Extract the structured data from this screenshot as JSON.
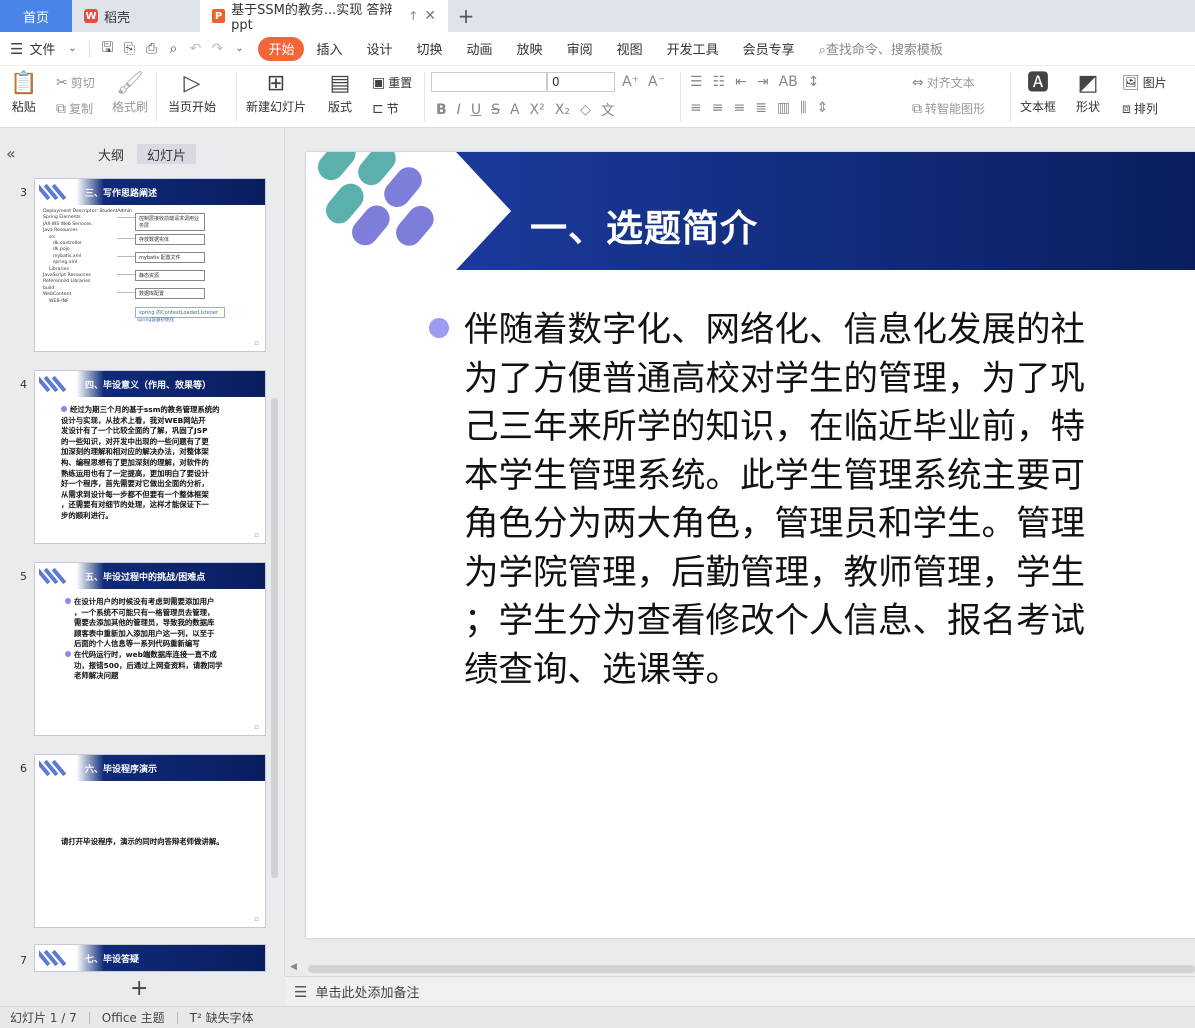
{
  "tabs": {
    "home": "首页",
    "daoke": "稻壳",
    "doc": "基于SSM的教务...实现 答辩ppt"
  },
  "menu": {
    "file": "文件",
    "items": [
      "开始",
      "插入",
      "设计",
      "切换",
      "动画",
      "放映",
      "审阅",
      "视图",
      "开发工具",
      "会员专享"
    ],
    "search": "查找命令、搜索模板"
  },
  "ribbon": {
    "paste": "粘贴",
    "cut": "剪切",
    "copy": "复制",
    "format_painter": "格式刷",
    "play_from_current": "当页开始",
    "new_slide": "新建幻灯片",
    "layout": "版式",
    "reset": "重置",
    "section": "节",
    "font_size": "0",
    "align_text": "对齐文本",
    "smart_graphic": "转智能图形",
    "textbox": "文本框",
    "shape": "形状",
    "picture": "图片",
    "arrange": "排列"
  },
  "panel": {
    "tab_outline": "大纲",
    "tab_slides": "幻灯片"
  },
  "thumbs": [
    {
      "num": "3",
      "title": "三、写作思路阐述",
      "tree": [
        "Deployment Descriptor: StudentAdmin",
        "Spring Elements",
        "JAX-WS Web Services",
        "Java Resources",
        "src",
        "dk.controller",
        "dk.pojo",
        "mybatis.xml",
        "spring.xml",
        "Libraries",
        "JavaScript Resources",
        "Referenced Libraries",
        "build",
        "WebContent",
        "WEB-INF"
      ],
      "boxes": [
        "控制层接收前端请求调用业务层",
        "存放数据实体",
        "mybatis 配置文件",
        "静态资源",
        "数据库配置"
      ],
      "note1": "spring 的ContextLoaderListener",
      "note2": "spring容器初始化"
    },
    {
      "num": "4",
      "title": "四、毕设意义（作用、效果等）",
      "text": [
        "经过为期三个月的基于ssm的教务管理系统的",
        "设计与实现，从技术上看，我对WEB网站开",
        "发设计有了一个比较全面的了解，巩固了JSP",
        "的一些知识，对开发中出现的一些问题有了更",
        "加深刻的理解和相对应的解决办法，对整体架",
        "构、编程思想有了更加深刻的理解，对软件的",
        "熟练运用也有了一定提高，更加明白了要设计",
        "好一个程序，首先需要对它做出全面的分析，",
        "从需求到设计每一步都不但要有一个整体框架",
        "，还需要有对细节的处理，这样才能保证下一",
        "步的顺利进行。"
      ]
    },
    {
      "num": "5",
      "title": "五、毕设过程中的挑战/困难点",
      "text1": [
        "在设计用户的时候没有考虑到需要添加用户",
        "，一个系统不可能只有一格管理员去管理，",
        "需要去添加其他的管理员，导致我的数据库",
        "顾客表中重新加入添加用户这一列，以至于",
        "后面的个人信息等一系列代码重新编写"
      ],
      "text2": [
        "在代码运行时，web端数据库连接一直不成",
        "功，报错500，后通过上网查资料，请教同学",
        "老师解决问题"
      ]
    },
    {
      "num": "6",
      "title": "六、毕设程序演示",
      "text": "请打开毕设程序，演示的同时向答辩老师做讲解。"
    },
    {
      "num": "7",
      "title": "七、毕设答疑"
    }
  ],
  "slide": {
    "title": "一、选题简介",
    "lines": [
      "伴随着数字化、网络化、信息化发展的社",
      "为了方便普通高校对学生的管理，为了巩",
      "己三年来所学的知识，在临近毕业前，特",
      "本学生管理系统。此学生管理系统主要可",
      "角色分为两大角色，管理员和学生。管理",
      "为学院管理，后勤管理，教师管理，学生",
      "；学生分为查看修改个人信息、报名考试",
      "绩查询、选课等。"
    ]
  },
  "notes": {
    "placeholder": "单击此处添加备注"
  },
  "status": {
    "slide_count": "幻灯片 1 / 7",
    "theme": "Office 主题",
    "missing_font": "缺失字体"
  },
  "colors": {
    "header_navy": "#0a1e5e",
    "accent_orange": "#f4663a",
    "bullet_purple": "#9b9bf2",
    "tab_blue": "#4a86e8"
  }
}
